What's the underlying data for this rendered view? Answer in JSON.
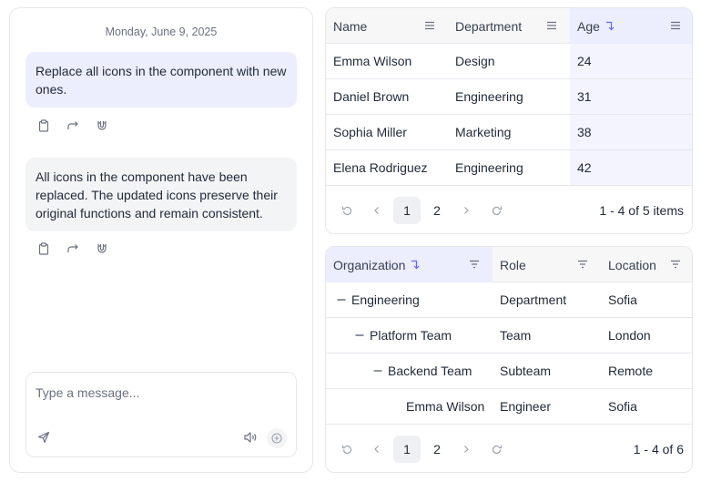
{
  "chat": {
    "date": "Monday, June 9, 2025",
    "messages": [
      {
        "role": "user",
        "text": "Replace all icons in the component with new ones."
      },
      {
        "role": "assistant",
        "text": "All icons in the component have been replaced. The updated icons preserve their original functions and remain consistent."
      }
    ],
    "composer": {
      "placeholder": "Type a message..."
    }
  },
  "employees_grid": {
    "columns": [
      {
        "label": "Name",
        "sorted": false
      },
      {
        "label": "Department",
        "sorted": false
      },
      {
        "label": "Age",
        "sorted": true,
        "sort_dir": "ascending"
      }
    ],
    "rows": [
      {
        "name": "Emma Wilson",
        "department": "Design",
        "age": "24"
      },
      {
        "name": "Daniel Brown",
        "department": "Engineering",
        "age": "31"
      },
      {
        "name": "Sophia Miller",
        "department": "Marketing",
        "age": "38"
      },
      {
        "name": "Elena Rodriguez",
        "department": "Engineering",
        "age": "42"
      }
    ],
    "pager": {
      "pages": [
        "1",
        "2"
      ],
      "current": "1",
      "info": "1 - 4 of 5 items"
    }
  },
  "org_grid": {
    "columns": [
      {
        "label": "Organization",
        "sorted": true,
        "sort_dir": "ascending"
      },
      {
        "label": "Role",
        "sorted": false
      },
      {
        "label": "Location",
        "sorted": false
      }
    ],
    "rows": [
      {
        "organization": "Engineering",
        "role": "Department",
        "location": "Sofia",
        "level": 0,
        "expanded": true
      },
      {
        "organization": "Platform Team",
        "role": "Team",
        "location": "London",
        "level": 1,
        "expanded": true
      },
      {
        "organization": "Backend Team",
        "role": "Subteam",
        "location": "Remote",
        "level": 2,
        "expanded": true
      },
      {
        "organization": "Emma Wilson",
        "role": "Engineer",
        "location": "Sofia",
        "level": 3,
        "expanded": null
      }
    ],
    "pager": {
      "pages": [
        "1",
        "2"
      ],
      "current": "1",
      "info": "1 - 4 of 6"
    }
  },
  "colors": {
    "accent": "#6366f1",
    "user_bubble": "#ecedfd",
    "assistant_bubble": "#f3f4f6",
    "sorted_header": "#ecedfd",
    "sorted_column": "#f3f4fd",
    "border": "#e5e7eb"
  },
  "icons": {
    "message_actions": [
      "clipboard-icon",
      "share-forward-icon",
      "magnet-icon"
    ],
    "composer": [
      "send-icon",
      "voice-icon",
      "add-attachment-icon"
    ],
    "header": [
      "sort-ascending-icon",
      "column-menu-icon",
      "filter-icon"
    ],
    "pager": [
      "refresh-reset-icon",
      "chevron-left-icon",
      "chevron-right-icon",
      "reload-icon"
    ],
    "tree": [
      "collapse-minus-icon"
    ]
  }
}
